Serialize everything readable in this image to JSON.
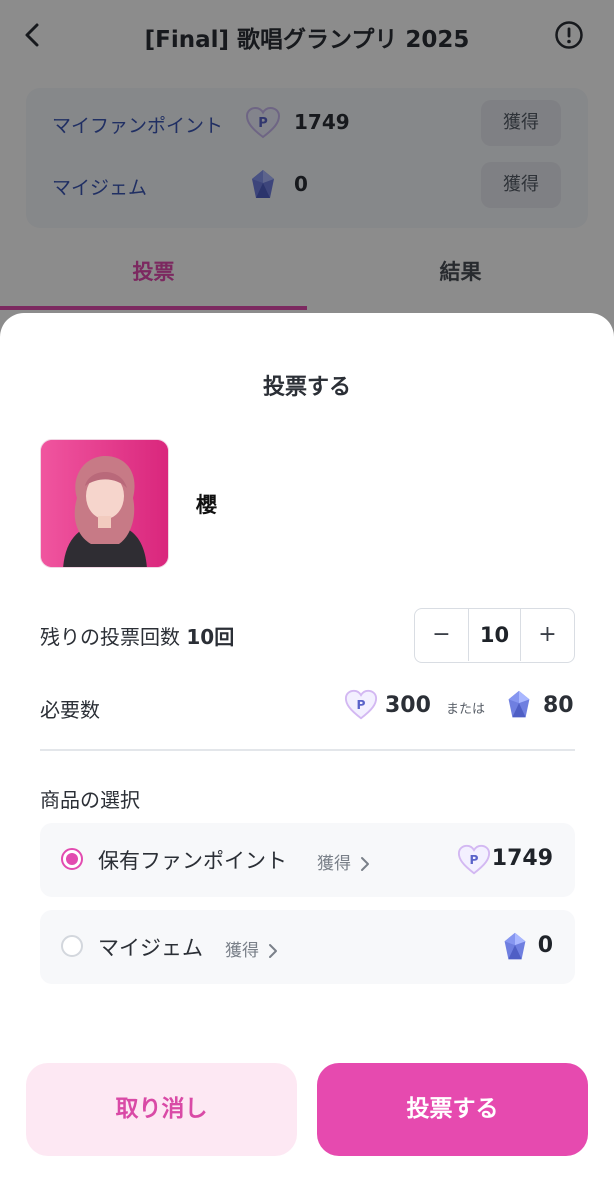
{
  "header": {
    "title": "[Final] 歌唱グランプリ 2025",
    "back_icon": "chevron-left-icon",
    "info_icon": "exclamation-circle-icon"
  },
  "points_card": {
    "fan_point_label": "マイファンポイント",
    "fan_point_value": "1749",
    "fan_point_icon": "fan-point-heart-icon",
    "gem_label": "マイジェム",
    "gem_value": "0",
    "gem_icon": "gem-icon",
    "earn_label": "獲得"
  },
  "tabs": [
    {
      "label": "投票",
      "active": true
    },
    {
      "label": "結果",
      "active": false
    }
  ],
  "sheet": {
    "title": "投票する",
    "candidate": {
      "name": "櫻"
    },
    "remaining": {
      "label": "残りの投票回数",
      "count": "10回"
    },
    "stepper": {
      "minus": "−",
      "value": "10",
      "plus": "+"
    },
    "required": {
      "label": "必要数",
      "points": "300",
      "or": "または",
      "gems": "80"
    },
    "select_label": "商品の選択",
    "options": [
      {
        "label": "保有ファンポイント",
        "earn": "獲得",
        "value": "1749",
        "selected": true,
        "icon": "fan-point-heart-icon"
      },
      {
        "label": "マイジェム",
        "earn": "獲得",
        "value": "0",
        "selected": false,
        "icon": "gem-icon"
      }
    ],
    "buttons": {
      "cancel": "取り消し",
      "vote": "投票する"
    }
  },
  "colors": {
    "accent": "#e64aaf",
    "accent_light": "#fde8f3",
    "link_blue": "#3b56b5",
    "overlay": "rgba(0,0,0,0.45)"
  }
}
